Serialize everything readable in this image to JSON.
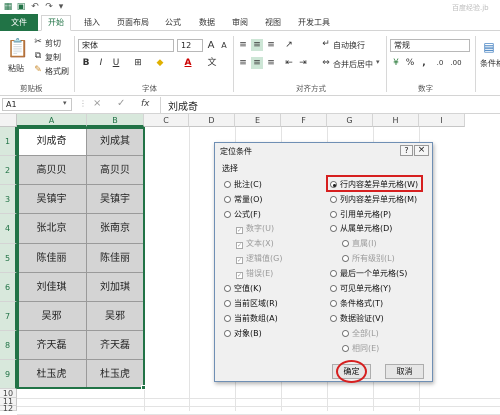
{
  "titlebar": {
    "watermark": "百度经验.jb"
  },
  "tabs": [
    "开始",
    "插入",
    "页面布局",
    "公式",
    "数据",
    "审阅",
    "视图",
    "开发工具"
  ],
  "file_tab": "文件",
  "ribbon": {
    "cut": "剪切",
    "copy": "复制",
    "format_painter": "格式刷",
    "paste_label": "粘贴",
    "clipboard_group": "剪贴板",
    "font_name": "宋体",
    "font_size": "12",
    "font_group": "字体",
    "wrap_text": "自动换行",
    "merge_center": "合并后居中",
    "align_group": "对齐方式",
    "number_format": "常规",
    "number_group": "数字",
    "conditional_format": "条件格",
    "bold": "B",
    "italic": "I",
    "underline": "U",
    "font_color_a": "A",
    "grow_font": "A",
    "percent": "%",
    "comma": ",",
    "currency": "¥"
  },
  "formula_bar": {
    "name_box": "A1",
    "fx": "fx",
    "cancel": "×",
    "enter": "✓",
    "content": "刘成奇"
  },
  "columns": [
    "A",
    "B",
    "C",
    "D",
    "E",
    "F",
    "G",
    "H",
    "I"
  ],
  "rows": [
    "1",
    "2",
    "3",
    "4",
    "5",
    "6",
    "7",
    "8",
    "9",
    "10",
    "11",
    "12"
  ],
  "cells": [
    [
      "刘成奇",
      "刘成其"
    ],
    [
      "高贝贝",
      "高贝贝"
    ],
    [
      "吴镇宇",
      "吴镇宇"
    ],
    [
      "张北京",
      "张南京"
    ],
    [
      "陈佳丽",
      "陈佳丽"
    ],
    [
      "刘佳琪",
      "刘加琪"
    ],
    [
      "吴邪",
      "吴邪"
    ],
    [
      "齐天磊",
      "齐天磊"
    ],
    [
      "杜玉虎",
      "杜玉虎"
    ]
  ],
  "dialog": {
    "title": "定位条件",
    "help": "?",
    "close": "×",
    "section": "选择",
    "left_options": [
      {
        "label": "批注(C)",
        "type": "radio"
      },
      {
        "label": "常量(O)",
        "type": "radio"
      },
      {
        "label": "公式(F)",
        "type": "radio"
      },
      {
        "label": "数字(U)",
        "type": "check",
        "disabled": true
      },
      {
        "label": "文本(X)",
        "type": "check",
        "disabled": true
      },
      {
        "label": "逻辑值(G)",
        "type": "check",
        "disabled": true
      },
      {
        "label": "错误(E)",
        "type": "check",
        "disabled": true
      },
      {
        "label": "空值(K)",
        "type": "radio"
      },
      {
        "label": "当前区域(R)",
        "type": "radio"
      },
      {
        "label": "当前数组(A)",
        "type": "radio"
      },
      {
        "label": "对象(B)",
        "type": "radio"
      }
    ],
    "right_options": [
      {
        "label": "行内容差异单元格(W)",
        "type": "radio",
        "selected": true
      },
      {
        "label": "列内容差异单元格(M)",
        "type": "radio"
      },
      {
        "label": "引用单元格(P)",
        "type": "radio"
      },
      {
        "label": "从属单元格(D)",
        "type": "radio"
      },
      {
        "label": "直属(I)",
        "type": "radio",
        "disabled": true,
        "sub": true
      },
      {
        "label": "所有级别(L)",
        "type": "radio",
        "disabled": true,
        "sub": true
      },
      {
        "label": "最后一个单元格(S)",
        "type": "radio"
      },
      {
        "label": "可见单元格(Y)",
        "type": "radio"
      },
      {
        "label": "条件格式(T)",
        "type": "radio"
      },
      {
        "label": "数据验证(V)",
        "type": "radio"
      },
      {
        "label": "全部(L)",
        "type": "radio",
        "disabled": true,
        "sub": true
      },
      {
        "label": "相同(E)",
        "type": "radio",
        "disabled": true,
        "sub": true
      }
    ],
    "ok": "确定",
    "cancel": "取消"
  },
  "colors": {
    "excel_green": "#217346",
    "highlight_red": "#d61f1f",
    "selection_green": "#217346"
  }
}
